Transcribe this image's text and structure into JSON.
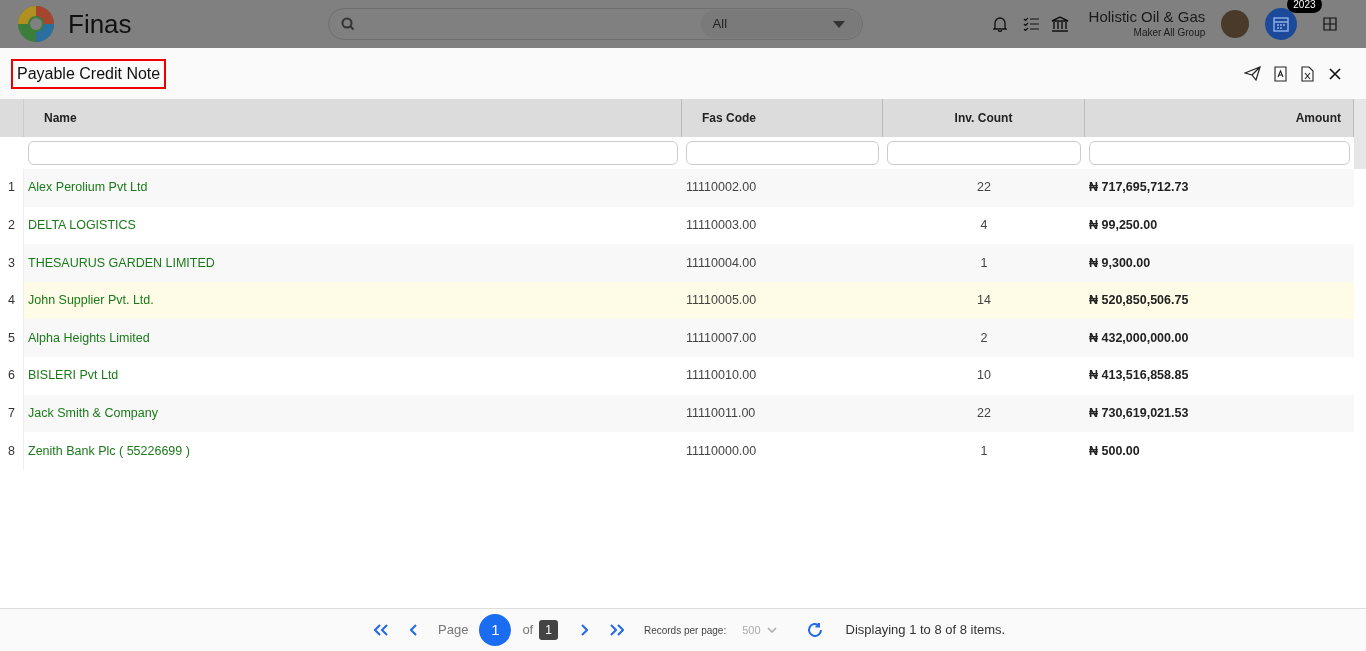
{
  "app": {
    "name": "Finas"
  },
  "search": {
    "scope": "All"
  },
  "company": {
    "name": "Holistic Oil & Gas",
    "group": "Maker All Group"
  },
  "year_badge": "2023",
  "page": {
    "title": "Payable Credit Note"
  },
  "table": {
    "columns": [
      "Name",
      "Fas Code",
      "Inv. Count",
      "Amount"
    ],
    "rows": [
      {
        "index": "1",
        "name": "Alex Perolium Pvt Ltd",
        "fas_code": "11110002.00",
        "inv_count": "22",
        "amount": "₦ 717,695,712.73",
        "selected": false
      },
      {
        "index": "2",
        "name": "DELTA LOGISTICS",
        "fas_code": "11110003.00",
        "inv_count": "4",
        "amount": "₦ 99,250.00",
        "selected": false
      },
      {
        "index": "3",
        "name": "THESAURUS GARDEN LIMITED",
        "fas_code": "11110004.00",
        "inv_count": "1",
        "amount": "₦ 9,300.00",
        "selected": false
      },
      {
        "index": "4",
        "name": "John Supplier Pvt. Ltd.",
        "fas_code": "11110005.00",
        "inv_count": "14",
        "amount": "₦ 520,850,506.75",
        "selected": true
      },
      {
        "index": "5",
        "name": "Alpha Heights Limited",
        "fas_code": "11110007.00",
        "inv_count": "2",
        "amount": "₦ 432,000,000.00",
        "selected": false
      },
      {
        "index": "6",
        "name": "BISLERI Pvt Ltd",
        "fas_code": "11110010.00",
        "inv_count": "10",
        "amount": "₦ 413,516,858.85",
        "selected": false
      },
      {
        "index": "7",
        "name": "Jack Smith & Company",
        "fas_code": "11110011.00",
        "inv_count": "22",
        "amount": "₦ 730,619,021.53",
        "selected": false
      },
      {
        "index": "8",
        "name": "Zenith Bank Plc ( 55226699 )",
        "fas_code": "11110000.00",
        "inv_count": "1",
        "amount": "₦ 500.00",
        "selected": false
      }
    ]
  },
  "pager": {
    "page_label": "Page",
    "page": "1",
    "of_label": "of",
    "total_pages": "1",
    "records_label": "Records per page:",
    "records_per_page": "500",
    "summary": "Displaying 1 to 8 of 8 items."
  }
}
